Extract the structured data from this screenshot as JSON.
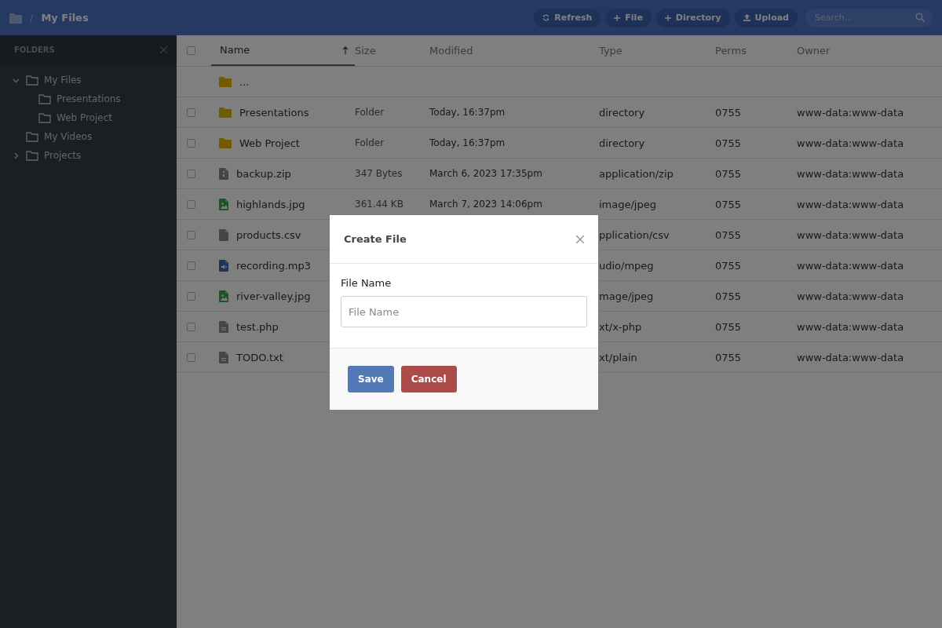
{
  "breadcrumb": {
    "separator": "/",
    "current": "My Files"
  },
  "toolbar": {
    "buttons": [
      {
        "label": "Refresh",
        "kind": "refresh"
      },
      {
        "label": "File",
        "kind": "add"
      },
      {
        "label": "Directory",
        "kind": "add"
      },
      {
        "label": "Upload",
        "kind": "upload"
      }
    ],
    "search": {
      "placeholder": "Search..."
    }
  },
  "sidebar": {
    "title": "FOLDERS",
    "items": [
      {
        "label": "My Files",
        "expanded": true,
        "children": [
          {
            "label": "Presentations"
          },
          {
            "label": "Web Project"
          }
        ]
      },
      {
        "label": "My Videos"
      },
      {
        "label": "Projects",
        "expanded": false
      }
    ]
  },
  "table": {
    "columns": [
      {
        "label": "Name",
        "sorted": true
      },
      {
        "label": "Size",
        "sorted": false
      },
      {
        "label": "Modified",
        "sorted": false
      },
      {
        "label": "Type",
        "sorted": false
      },
      {
        "label": "Perms",
        "sorted": false
      },
      {
        "label": "Owner",
        "sorted": false
      }
    ],
    "header_checked": false,
    "rows": [
      {
        "kind": "parent",
        "name": "..."
      },
      {
        "kind": "folder",
        "checked": false,
        "name": "Presentations",
        "size": "Folder",
        "modified": "Today, 16:37pm",
        "type": "directory",
        "perms": "0755",
        "owner": "www-data:www-data"
      },
      {
        "kind": "folder",
        "checked": false,
        "name": "Web Project",
        "size": "Folder",
        "modified": "Today, 16:37pm",
        "type": "directory",
        "perms": "0755",
        "owner": "www-data:www-data"
      },
      {
        "kind": "zip",
        "checked": false,
        "name": "backup.zip",
        "size": "347 Bytes",
        "modified": "March 6, 2023 17:35pm",
        "type": "application/zip",
        "perms": "0755",
        "owner": "www-data:www-data"
      },
      {
        "kind": "image",
        "checked": false,
        "name": "highlands.jpg",
        "size": "361.44 KB",
        "modified": "March 7, 2023 14:06pm",
        "type": "image/jpeg",
        "perms": "0755",
        "owner": "www-data:www-data"
      },
      {
        "kind": "file",
        "checked": false,
        "name": "products.csv",
        "type": "pplication/csv",
        "perms": "0755",
        "owner": "www-data:www-data"
      },
      {
        "kind": "audio",
        "checked": false,
        "name": "recording.mp3",
        "type": "udio/mpeg",
        "perms": "0755",
        "owner": "www-data:www-data"
      },
      {
        "kind": "image",
        "checked": false,
        "name": "river-valley.jpg",
        "type": "mage/jpeg",
        "perms": "0755",
        "owner": "www-data:www-data"
      },
      {
        "kind": "text",
        "checked": false,
        "name": "test.php",
        "type": "xt/x-php",
        "perms": "0755",
        "owner": "www-data:www-data"
      },
      {
        "kind": "text",
        "checked": false,
        "name": "TODO.txt",
        "type": "xt/plain",
        "perms": "0755",
        "owner": "www-data:www-data"
      }
    ]
  },
  "modal": {
    "title": "Create File",
    "field_label": "File Name",
    "placeholder": "File Name",
    "buttons": [
      {
        "label": "Save",
        "kind": "primary"
      },
      {
        "label": "Cancel",
        "kind": "danger"
      }
    ]
  }
}
